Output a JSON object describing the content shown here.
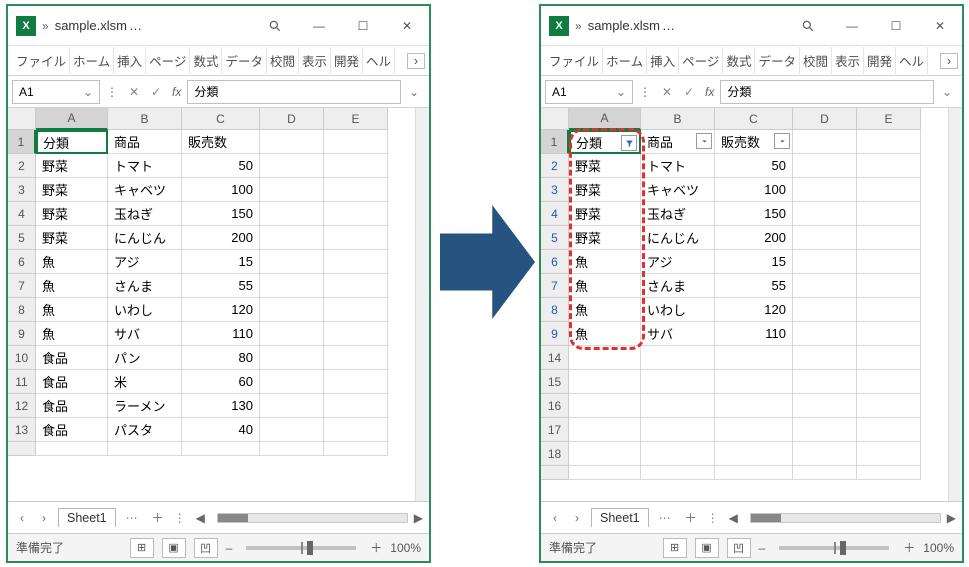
{
  "window": {
    "title": "sample.xlsm",
    "title_suffix": "…"
  },
  "namebox": "A1",
  "formula": "分類",
  "ribbon": [
    "ファイル",
    "ホーム",
    "挿入",
    "ページ",
    "数式",
    "データ",
    "校閲",
    "表示",
    "開発",
    "ヘル"
  ],
  "columns": [
    "A",
    "B",
    "C",
    "D",
    "E"
  ],
  "headers": {
    "a": "分類",
    "b": "商品",
    "c": "販売数"
  },
  "rows_left": [
    {
      "n": 1,
      "a": "分類",
      "b": "商品",
      "c": "販売数",
      "hdr": true
    },
    {
      "n": 2,
      "a": "野菜",
      "b": "トマト",
      "c": "50"
    },
    {
      "n": 3,
      "a": "野菜",
      "b": "キャベツ",
      "c": "100"
    },
    {
      "n": 4,
      "a": "野菜",
      "b": "玉ねぎ",
      "c": "150"
    },
    {
      "n": 5,
      "a": "野菜",
      "b": "にんじん",
      "c": "200"
    },
    {
      "n": 6,
      "a": "魚",
      "b": "アジ",
      "c": "15"
    },
    {
      "n": 7,
      "a": "魚",
      "b": "さんま",
      "c": "55"
    },
    {
      "n": 8,
      "a": "魚",
      "b": "いわし",
      "c": "120"
    },
    {
      "n": 9,
      "a": "魚",
      "b": "サバ",
      "c": "110"
    },
    {
      "n": 10,
      "a": "食品",
      "b": "パン",
      "c": "80"
    },
    {
      "n": 11,
      "a": "食品",
      "b": "米",
      "c": "60"
    },
    {
      "n": 12,
      "a": "食品",
      "b": "ラーメン",
      "c": "130"
    },
    {
      "n": 13,
      "a": "食品",
      "b": "パスタ",
      "c": "40"
    }
  ],
  "rows_right_visible": [
    {
      "n": 1,
      "a": "分類",
      "b": "商品",
      "c": "販売数",
      "hdr": true,
      "filter_a_active": true
    },
    {
      "n": 2,
      "a": "野菜",
      "b": "トマト",
      "c": "50",
      "filt": true
    },
    {
      "n": 3,
      "a": "野菜",
      "b": "キャベツ",
      "c": "100",
      "filt": true
    },
    {
      "n": 4,
      "a": "野菜",
      "b": "玉ねぎ",
      "c": "150",
      "filt": true
    },
    {
      "n": 5,
      "a": "野菜",
      "b": "にんじん",
      "c": "200",
      "filt": true
    },
    {
      "n": 6,
      "a": "魚",
      "b": "アジ",
      "c": "15",
      "filt": true
    },
    {
      "n": 7,
      "a": "魚",
      "b": "さんま",
      "c": "55",
      "filt": true
    },
    {
      "n": 8,
      "a": "魚",
      "b": "いわし",
      "c": "120",
      "filt": true
    },
    {
      "n": 9,
      "a": "魚",
      "b": "サバ",
      "c": "110",
      "filt": true
    },
    {
      "n": 14,
      "a": "",
      "b": "",
      "c": ""
    },
    {
      "n": 15,
      "a": "",
      "b": "",
      "c": ""
    },
    {
      "n": 16,
      "a": "",
      "b": "",
      "c": ""
    },
    {
      "n": 17,
      "a": "",
      "b": "",
      "c": ""
    },
    {
      "n": 18,
      "a": "",
      "b": "",
      "c": ""
    }
  ],
  "sheet_tab": "Sheet1",
  "status_ready": "準備完了",
  "zoom": "100%"
}
